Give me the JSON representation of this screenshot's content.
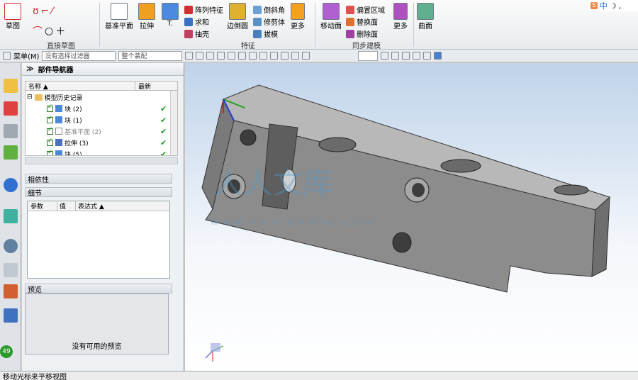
{
  "ribbon": {
    "sketch": "草图",
    "direct_sketch_group": "直接草图",
    "datum_plane": "基准平面",
    "extrude": "拉伸",
    "hole": "孔",
    "pattern_feature": "阵列特征",
    "unite": "求和",
    "chamfer": "倒斜角",
    "shell": "抽壳",
    "edge_blend": "边倒圆",
    "draft": "拔模",
    "feature_group": "特征",
    "more1": "更多",
    "move_face": "移动面",
    "offset_region": "偏置区域",
    "replace_face": "替换面",
    "delete_face": "删除面",
    "more2": "更多",
    "sync_group": "同步建模",
    "surface": "曲面",
    "tab_indicator": "T."
  },
  "toolbar": {
    "menu": "菜单(M)",
    "filter1": "没有选择过滤器",
    "filter2": "整个装配"
  },
  "navigator": {
    "title": "部件导航器",
    "col_name": "名称",
    "col_latest": "最新",
    "history": "模型历史记录",
    "items": [
      {
        "label": "块 (2)"
      },
      {
        "label": "块 (1)"
      },
      {
        "label": "基准平面 (2)"
      },
      {
        "label": "拉伸 (3)"
      },
      {
        "label": "块 (5)"
      }
    ],
    "dependencies": "相依性",
    "details": "细节",
    "param_col": "参数",
    "value_col": "值",
    "expr_col": "表达式",
    "preview": "预览",
    "no_preview": "没有可用的预览"
  },
  "side_badge": "49",
  "watermark": {
    "brand": "人人文库",
    "url": "www.renrendoc.com"
  },
  "status": "移动光标来平移视图",
  "ime": "中",
  "colors": {
    "accent": "#2b6cbf",
    "part": "#8a8a8a",
    "green_check": "#1a9a1a"
  }
}
